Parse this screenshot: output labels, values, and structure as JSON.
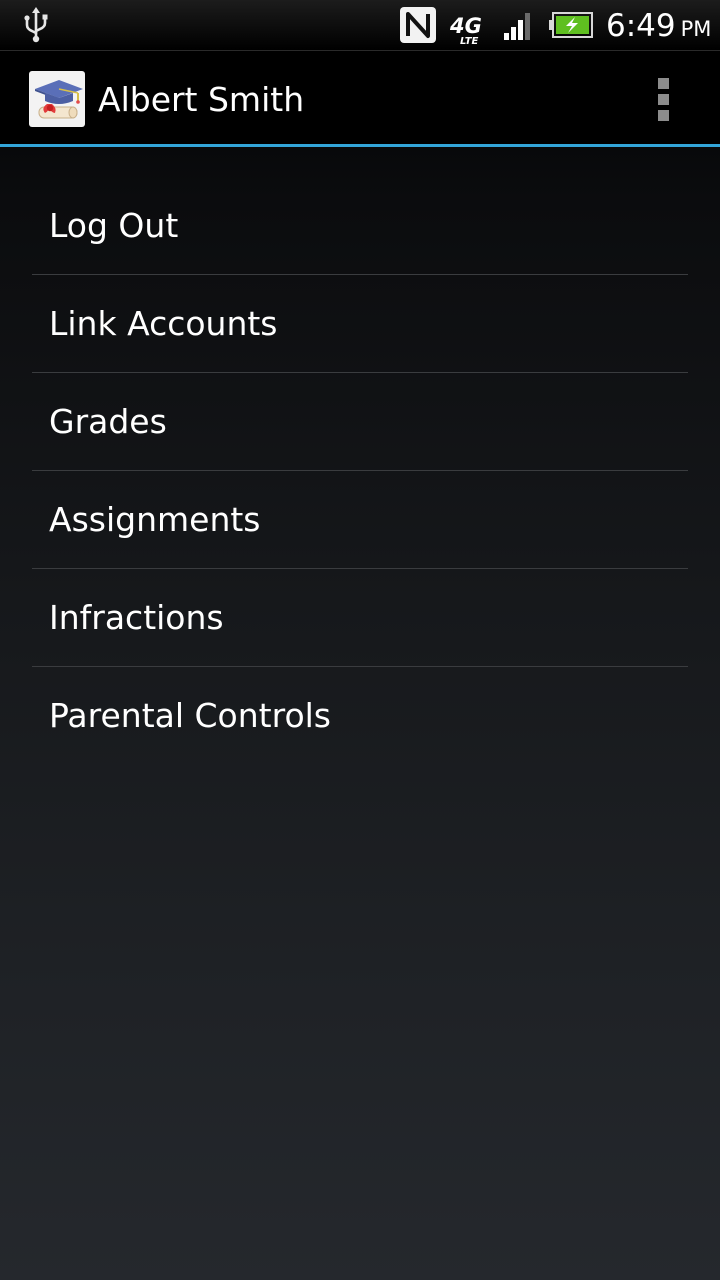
{
  "status_bar": {
    "time": "6:49",
    "ampm": "PM",
    "network_label": "4G",
    "network_sub": "LTE",
    "icons": [
      "usb-icon",
      "nfc-icon",
      "4g-lte-icon",
      "signal-icon",
      "battery-charging-icon"
    ]
  },
  "action_bar": {
    "title": "Albert Smith",
    "app_icon": "graduation-cap-diploma-icon",
    "overflow_icon": "overflow-menu-icon",
    "accent_color": "#33a5d8"
  },
  "menu": {
    "items": [
      {
        "label": "Log Out"
      },
      {
        "label": "Link Accounts"
      },
      {
        "label": "Grades"
      },
      {
        "label": "Assignments"
      },
      {
        "label": "Infractions"
      },
      {
        "label": "Parental Controls"
      }
    ]
  }
}
